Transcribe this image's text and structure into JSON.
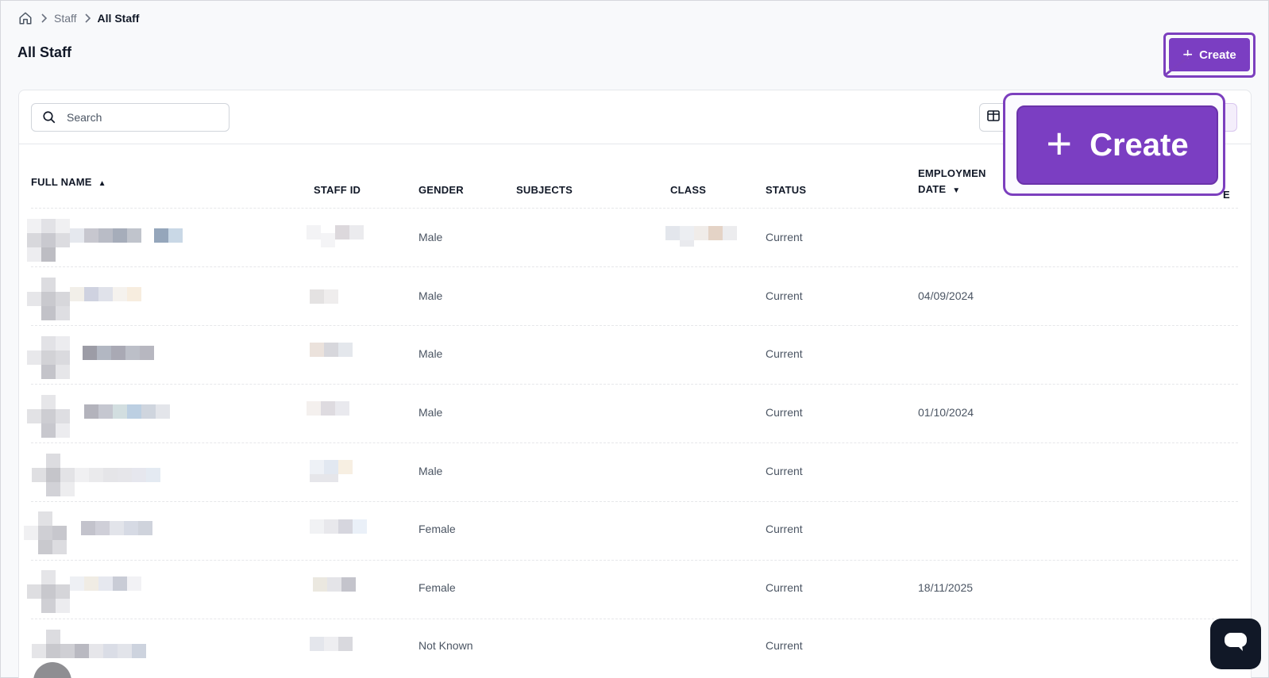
{
  "breadcrumb": {
    "items": [
      "Staff",
      "All Staff"
    ]
  },
  "page": {
    "title": "All Staff"
  },
  "create_button": {
    "label": "Create"
  },
  "zoom_callout": {
    "label": "Create"
  },
  "search": {
    "placeholder": "Search"
  },
  "table": {
    "headers": {
      "full_name": "FULL NAME",
      "staff_id": "STAFF ID",
      "gender": "GENDER",
      "subjects": "SUBJECTS",
      "class": "CLASS",
      "status": "STATUS",
      "employment_line1": "EMPLOYMEN",
      "employment_line2": "DATE",
      "last_col_fragment": "E"
    },
    "rows": [
      {
        "gender": "Male",
        "status": "Current",
        "employment_date": ""
      },
      {
        "gender": "Male",
        "status": "Current",
        "employment_date": "04/09/2024"
      },
      {
        "gender": "Male",
        "status": "Current",
        "employment_date": ""
      },
      {
        "gender": "Male",
        "status": "Current",
        "employment_date": "01/10/2024"
      },
      {
        "gender": "Male",
        "status": "Current",
        "employment_date": ""
      },
      {
        "gender": "Female",
        "status": "Current",
        "employment_date": ""
      },
      {
        "gender": "Female",
        "status": "Current",
        "employment_date": "18/11/2025"
      },
      {
        "gender": "Not Known",
        "status": "Current",
        "employment_date": ""
      }
    ]
  },
  "colors": {
    "accent": "#7b3ec2",
    "accent_outline": "#7c3fbe",
    "chat_bg": "#111827"
  },
  "icons": {
    "home": "home-icon",
    "chevron": "chevron-right-icon",
    "search": "search-icon",
    "columns": "columns-icon",
    "chat": "chat-icon",
    "sort_up": "sort-ascending-icon",
    "sort_down": "sort-descending-icon"
  }
}
